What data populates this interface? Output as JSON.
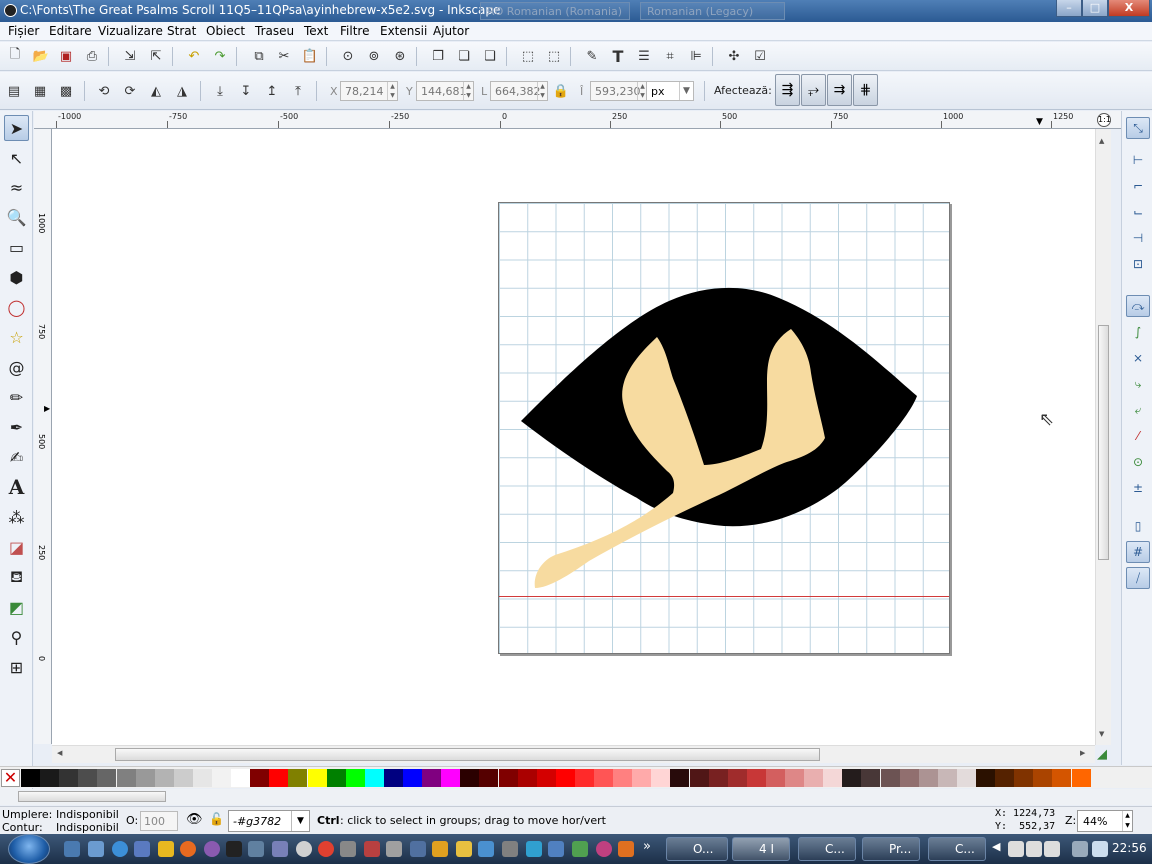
{
  "window": {
    "title": "C:\\Fonts\\The Great Psalms Scroll 11Q5–11QPsa\\ayinhebrew-x5e2.svg - Inkscape",
    "lang_1": "RO Romanian (Romania)",
    "lang_2": "Romanian (Legacy)",
    "minimize": "–",
    "maximize": "□",
    "close": "X"
  },
  "menu": [
    "Fișier",
    "Editare",
    "Vizualizare",
    "Strat",
    "Obiect",
    "Traseu",
    "Text",
    "Filtre",
    "Extensii",
    "Ajutor"
  ],
  "controls": {
    "x_label": "X",
    "x_value": "78,214",
    "y_label": "Y",
    "y_value": "144,681",
    "w_label": "L",
    "w_value": "664,382",
    "h_label": "Î",
    "h_value": "593,230",
    "unit": "px",
    "affect_label": "Afectează:"
  },
  "ruler": {
    "h_labels": [
      "-1000",
      "-750",
      "-500",
      "-250",
      "0",
      "250",
      "500",
      "750",
      "1000",
      "1250"
    ],
    "v_labels": [
      "1000",
      "750",
      "500",
      "250",
      "0"
    ]
  },
  "palette_colors": [
    "#000000",
    "#1a1a1a",
    "#333333",
    "#4d4d4d",
    "#666666",
    "#808080",
    "#999999",
    "#b3b3b3",
    "#cccccc",
    "#e6e6e6",
    "#f2f2f2",
    "#ffffff",
    "#800000",
    "#ff0000",
    "#808000",
    "#ffff00",
    "#008000",
    "#00ff00",
    "#00ffff",
    "#000080",
    "#0000ff",
    "#800080",
    "#ff00ff",
    "#2b0000",
    "#550000",
    "#800000",
    "#aa0000",
    "#d40000",
    "#ff0000",
    "#ff2a2a",
    "#ff5555",
    "#ff8080",
    "#ffaaaa",
    "#ffd5d5",
    "#280b0b",
    "#501616",
    "#782121",
    "#a02c2c",
    "#c83737",
    "#d35f5f",
    "#de8787",
    "#e9afaf",
    "#f4d7d7",
    "#241c1c",
    "#483737",
    "#6c5353",
    "#916f6f",
    "#ac9393",
    "#c8b7b7",
    "#e3dbdb",
    "#2b1100",
    "#552200",
    "#803300",
    "#aa4400",
    "#d45500",
    "#ff6600"
  ],
  "status": {
    "fill_label": "Umplere:",
    "fill_value": "Indisponibil",
    "stroke_label": "Contur:",
    "stroke_value": "Indisponibil",
    "opacity_label": "O:",
    "opacity_value": "100",
    "layer_value": "-#g3782",
    "message_key": "Ctrl",
    "message": ": click to select in groups; drag to move hor/vert",
    "x_coord": "X: 1224,73",
    "y_coord": "Y:  552,37",
    "zoom_label": "Z:",
    "zoom_value": "44%"
  },
  "taskbar": {
    "tasks": [
      "O...",
      "4 I",
      "C...",
      "Pr...",
      "C..."
    ],
    "clock": "22:56"
  },
  "colors": {
    "glyph_fill": "#f7dba0",
    "glyph_outline": "#000000",
    "baseline": "#d13a3a",
    "grid": "#bcd3e0"
  }
}
